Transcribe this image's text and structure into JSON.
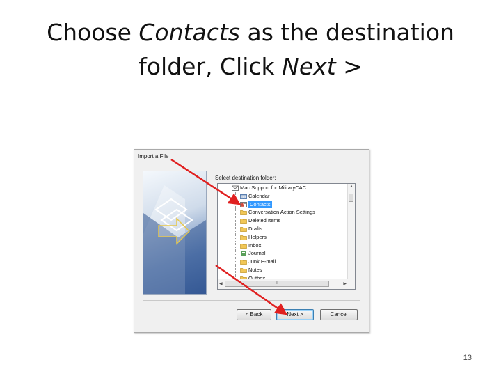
{
  "slide": {
    "title_part1": "Choose ",
    "title_em1": "Contacts",
    "title_part2": " as the destination",
    "title_line2": "folder, Click ",
    "title_em2": "Next >",
    "page_number": "13"
  },
  "dialog": {
    "title": "Import a File",
    "destination_label": "Select destination folder:",
    "folders": [
      {
        "label": "Mac Support for MilitaryCAC",
        "icon": "mailbox-icon",
        "level": 0,
        "selected": false
      },
      {
        "label": "Calendar",
        "icon": "calendar-icon",
        "level": 1,
        "selected": false
      },
      {
        "label": "Contacts",
        "icon": "contacts-icon",
        "level": 1,
        "selected": true
      },
      {
        "label": "Conversation Action Settings",
        "icon": "folder-icon",
        "level": 1,
        "selected": false
      },
      {
        "label": "Deleted Items",
        "icon": "folder-icon",
        "level": 1,
        "selected": false
      },
      {
        "label": "Drafts",
        "icon": "folder-icon",
        "level": 1,
        "selected": false
      },
      {
        "label": "Helpers",
        "icon": "folder-icon",
        "level": 1,
        "selected": false
      },
      {
        "label": "Inbox",
        "icon": "folder-icon",
        "level": 1,
        "selected": false
      },
      {
        "label": "Journal",
        "icon": "journal-icon",
        "level": 1,
        "selected": false
      },
      {
        "label": "Junk E-mail",
        "icon": "folder-icon",
        "level": 1,
        "selected": false
      },
      {
        "label": "Notes",
        "icon": "folder-icon",
        "level": 1,
        "selected": false
      },
      {
        "label": "Outbox",
        "icon": "folder-icon",
        "level": 1,
        "selected": false
      }
    ],
    "buttons": {
      "back": "< Back",
      "next": "Next >",
      "cancel": "Cancel"
    },
    "scroll_grip": "III"
  },
  "colors": {
    "arrow": "#e02020",
    "selection": "#3399ff",
    "folder": "#f1c757"
  }
}
